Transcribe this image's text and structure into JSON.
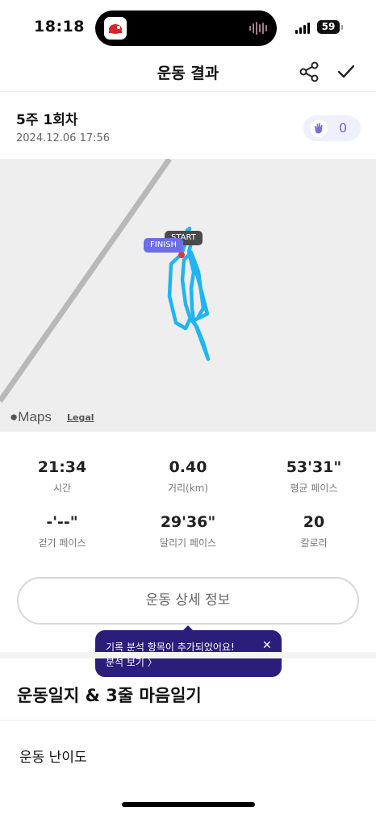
{
  "status_bar": {
    "time": "18:18",
    "battery": "59"
  },
  "header": {
    "title": "운동 결과",
    "share_icon": "share-icon",
    "done_icon": "check-icon"
  },
  "session": {
    "title": "5주 1회차",
    "date": "2024.12.06 17:56",
    "clap_count": "0"
  },
  "map": {
    "start_label": "START",
    "finish_label": "FINISH",
    "provider_label": "Maps",
    "legal_label": "Legal",
    "route_color": "#1fb5f0"
  },
  "stats": [
    {
      "value": "21:34",
      "label": "시간"
    },
    {
      "value": "0.40",
      "label": "거리(km)"
    },
    {
      "value": "53'31\"",
      "label": "평균 페이스"
    },
    {
      "value": "-'--\"",
      "label": "걷기 페이스"
    },
    {
      "value": "29'36\"",
      "label": "달리기 페이스"
    },
    {
      "value": "20",
      "label": "칼로리"
    }
  ],
  "detail_button": "운동 상세 정보",
  "tooltip": {
    "message": "기록 분석 항목이 추가되었어요!",
    "link": "분석 보기 〉",
    "close": "✕"
  },
  "journal": {
    "title": "운동일지 & 3줄 마음일기",
    "difficulty_label": "운동 난이도"
  },
  "colors": {
    "accent": "#6b63d9",
    "tooltip_bg": "#2b1d7a"
  }
}
